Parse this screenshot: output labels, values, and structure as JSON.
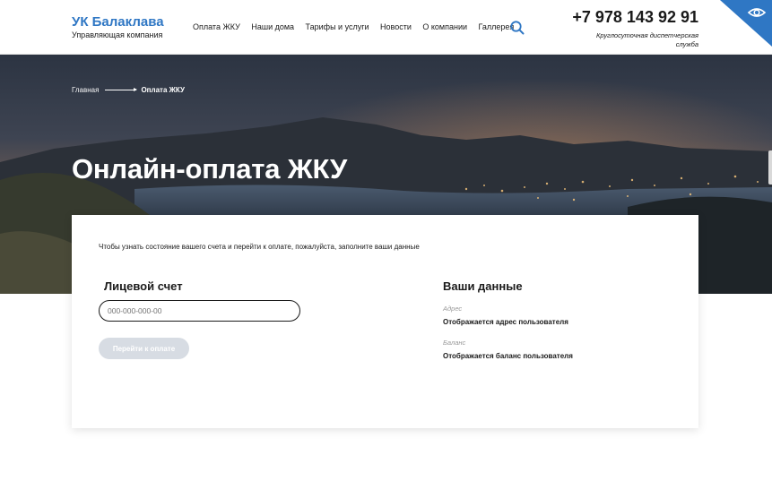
{
  "header": {
    "logo_title": "УК Балаклава",
    "logo_subtitle": "Управляющая компания",
    "nav": [
      {
        "label": "Оплата ЖКУ"
      },
      {
        "label": "Наши дома"
      },
      {
        "label": "Тарифы и услуги"
      },
      {
        "label": "Новости"
      },
      {
        "label": "О компании"
      },
      {
        "label": "Галлерея"
      }
    ],
    "search_icon": "search-icon",
    "phone": "+7 978 143 92 91",
    "phone_caption": "Круглосуточная диспетчерская служба",
    "accessibility_icon": "eye-icon"
  },
  "hero": {
    "breadcrumb_home": "Главная",
    "breadcrumb_current": "Оплата ЖКУ",
    "title": "Онлайн-оплата ЖКУ"
  },
  "card": {
    "intro": "Чтобы узнать состояние вашего счета и перейти к оплате, пожалуйста, заполните ваши данные",
    "account_title": "Лицевой счет",
    "account_placeholder": "000-000-000-00",
    "pay_button": "Перейти к оплате",
    "data_title": "Ваши данные",
    "address_label": "Адрес",
    "address_value": "Отображается адрес пользователя",
    "balance_label": "Баланс",
    "balance_value": "Отображается баланс пользователя"
  },
  "colors": {
    "brand_blue": "#2f77c4",
    "button_disabled": "#d7dce3",
    "text": "#1a1a1a"
  }
}
